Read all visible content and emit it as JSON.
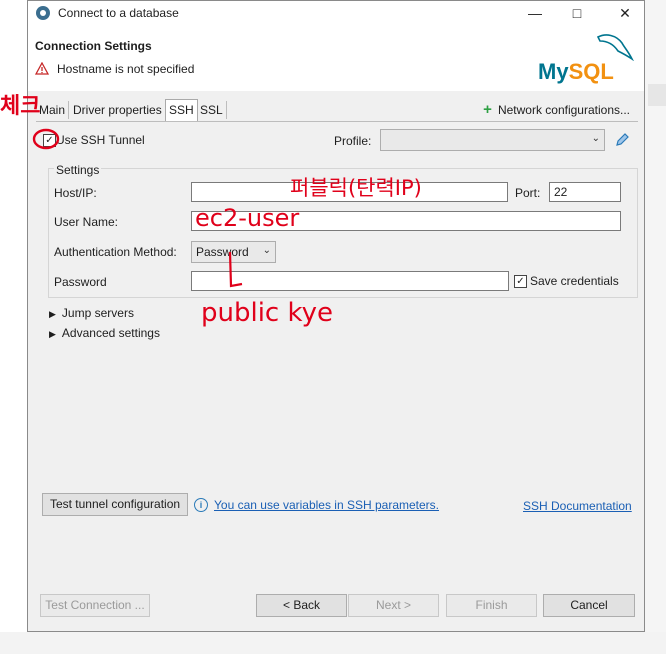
{
  "window": {
    "title": "Connect to a database"
  },
  "header": {
    "title": "Connection Settings",
    "warning": "Hostname is not specified",
    "logo_left": "My",
    "logo_right": "SQL"
  },
  "tabs": [
    {
      "label": "Main"
    },
    {
      "label": "Driver properties"
    },
    {
      "label": "SSH"
    },
    {
      "label": "SSL"
    }
  ],
  "network_config": "Network configurations...",
  "ssh": {
    "use_tunnel_label": "Use SSH Tunnel",
    "use_tunnel_checked": true,
    "profile_label": "Profile:",
    "profile_value": "",
    "settings_title": "Settings",
    "host_label": "Host/IP:",
    "host_value": "",
    "port_label": "Port:",
    "port_value": "22",
    "user_label": "User Name:",
    "user_value": "",
    "auth_label": "Authentication Method:",
    "auth_value": "Password",
    "password_label": "Password",
    "password_value": "",
    "save_credentials_label": "Save credentials",
    "save_credentials_checked": true,
    "jump_servers": "Jump servers",
    "advanced_settings": "Advanced settings",
    "test_tunnel": "Test tunnel configuration",
    "variables_link": "You can use variables in SSH parameters.",
    "docs_link": "SSH Documentation"
  },
  "footer": {
    "test_connection": "Test Connection ...",
    "back": "< Back",
    "next": "Next >",
    "finish": "Finish",
    "cancel": "Cancel"
  },
  "annotations": {
    "check": "체크",
    "public_ip": "퍼블릭(탄력IP)",
    "user": "ec2-user",
    "key": "public kye"
  },
  "colors": {
    "accent_link": "#1a5fb4",
    "annotation_ink": "#e0001a",
    "mysql_blue": "#00758f",
    "mysql_orange": "#f29111"
  }
}
